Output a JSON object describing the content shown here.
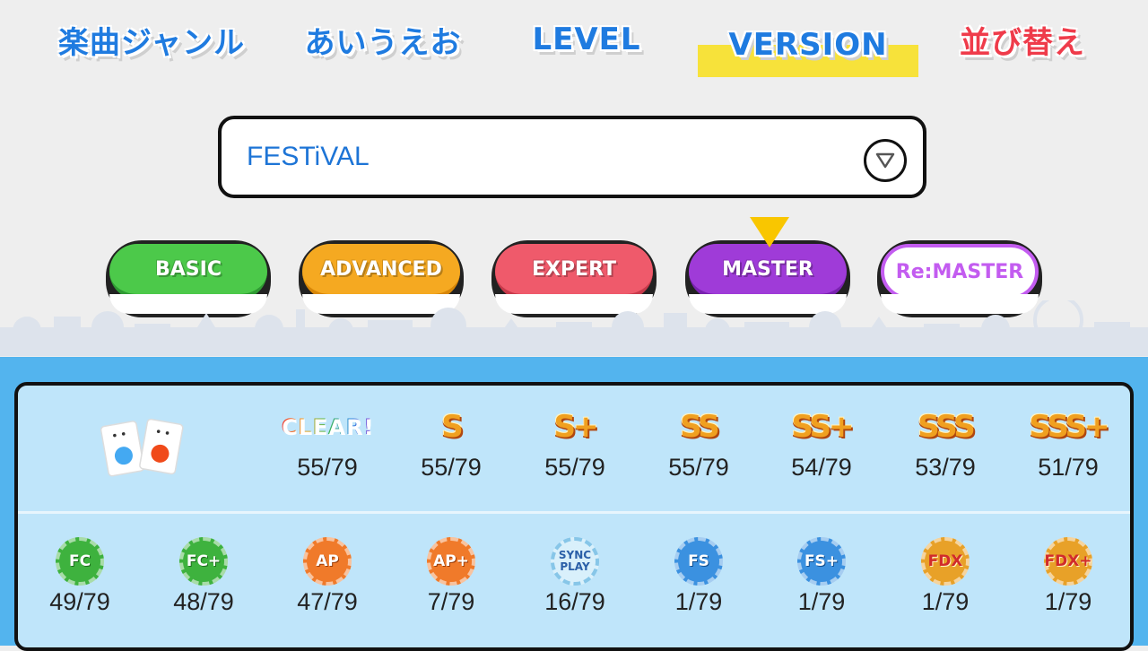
{
  "top_tabs": [
    {
      "label": "楽曲ジャンル",
      "active": false
    },
    {
      "label": "あいうえお",
      "active": false
    },
    {
      "label": "LEVEL",
      "active": false
    },
    {
      "label": "VERSION",
      "active": true
    },
    {
      "label": "並び替え",
      "active": false
    }
  ],
  "version_select": {
    "value": "FESTiVAL",
    "icon": "chevron-down-circle-icon"
  },
  "difficulties": [
    {
      "label": "BASIC",
      "color": "#4cc94a",
      "selected": false
    },
    {
      "label": "ADVANCED",
      "color": "#f5a921",
      "selected": false
    },
    {
      "label": "EXPERT",
      "color": "#ef5a6b",
      "selected": false
    },
    {
      "label": "MASTER",
      "color": "#9f3bd8",
      "selected": true
    },
    {
      "label": "Re:MASTER",
      "color": "#c35cf0",
      "selected": false
    }
  ],
  "rank_stats": [
    {
      "badge": "CLEAR!",
      "count": "55/79"
    },
    {
      "badge": "S",
      "count": "55/79"
    },
    {
      "badge": "S+",
      "count": "55/79"
    },
    {
      "badge": "SS",
      "count": "55/79"
    },
    {
      "badge": "SS+",
      "count": "54/79"
    },
    {
      "badge": "SSS",
      "count": "53/79"
    },
    {
      "badge": "SSS+",
      "count": "51/79"
    }
  ],
  "combo_stats": [
    {
      "badge": "FC",
      "count": "49/79"
    },
    {
      "badge": "FC+",
      "count": "48/79"
    },
    {
      "badge": "AP",
      "count": "47/79"
    },
    {
      "badge": "AP+",
      "count": "7/79"
    },
    {
      "badge": "SYNC PLAY",
      "count": "16/79"
    },
    {
      "badge": "FS",
      "count": "1/79"
    },
    {
      "badge": "FS+",
      "count": "1/79"
    },
    {
      "badge": "FDX",
      "count": "1/79"
    },
    {
      "badge": "FDX+",
      "count": "1/79"
    }
  ],
  "colors": {
    "accent_blue": "#1f7be0",
    "sort_red": "#ef3b4a",
    "highlight_yellow": "#f7e23a",
    "panel_bg": "#bfe5fa",
    "sea_blue": "#53b4ee"
  }
}
